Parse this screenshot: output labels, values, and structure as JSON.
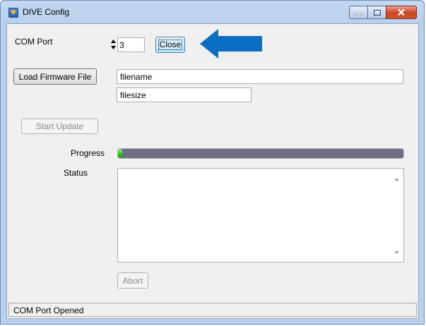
{
  "window": {
    "title": "DIVE Config",
    "controls": {
      "minimize": "minimize-icon",
      "maximize": "maximize-icon",
      "close": "close-icon"
    }
  },
  "com_port": {
    "label": "COM Port",
    "value": "3",
    "close_button": "Close"
  },
  "firmware": {
    "load_button": "Load Firmware File",
    "filename": "filename",
    "filesize": "filesize"
  },
  "update": {
    "start_button": "Start Update",
    "progress_label": "Progress",
    "progress_fraction": 0.01,
    "status_label": "Status",
    "status_text": "",
    "abort_button": "Abort"
  },
  "statusbar": {
    "text": "COM Port Opened"
  },
  "colors": {
    "annotation_arrow": "#0a6fc2",
    "progress_track": "#6e6e84",
    "progress_fill": "#26c20e"
  }
}
